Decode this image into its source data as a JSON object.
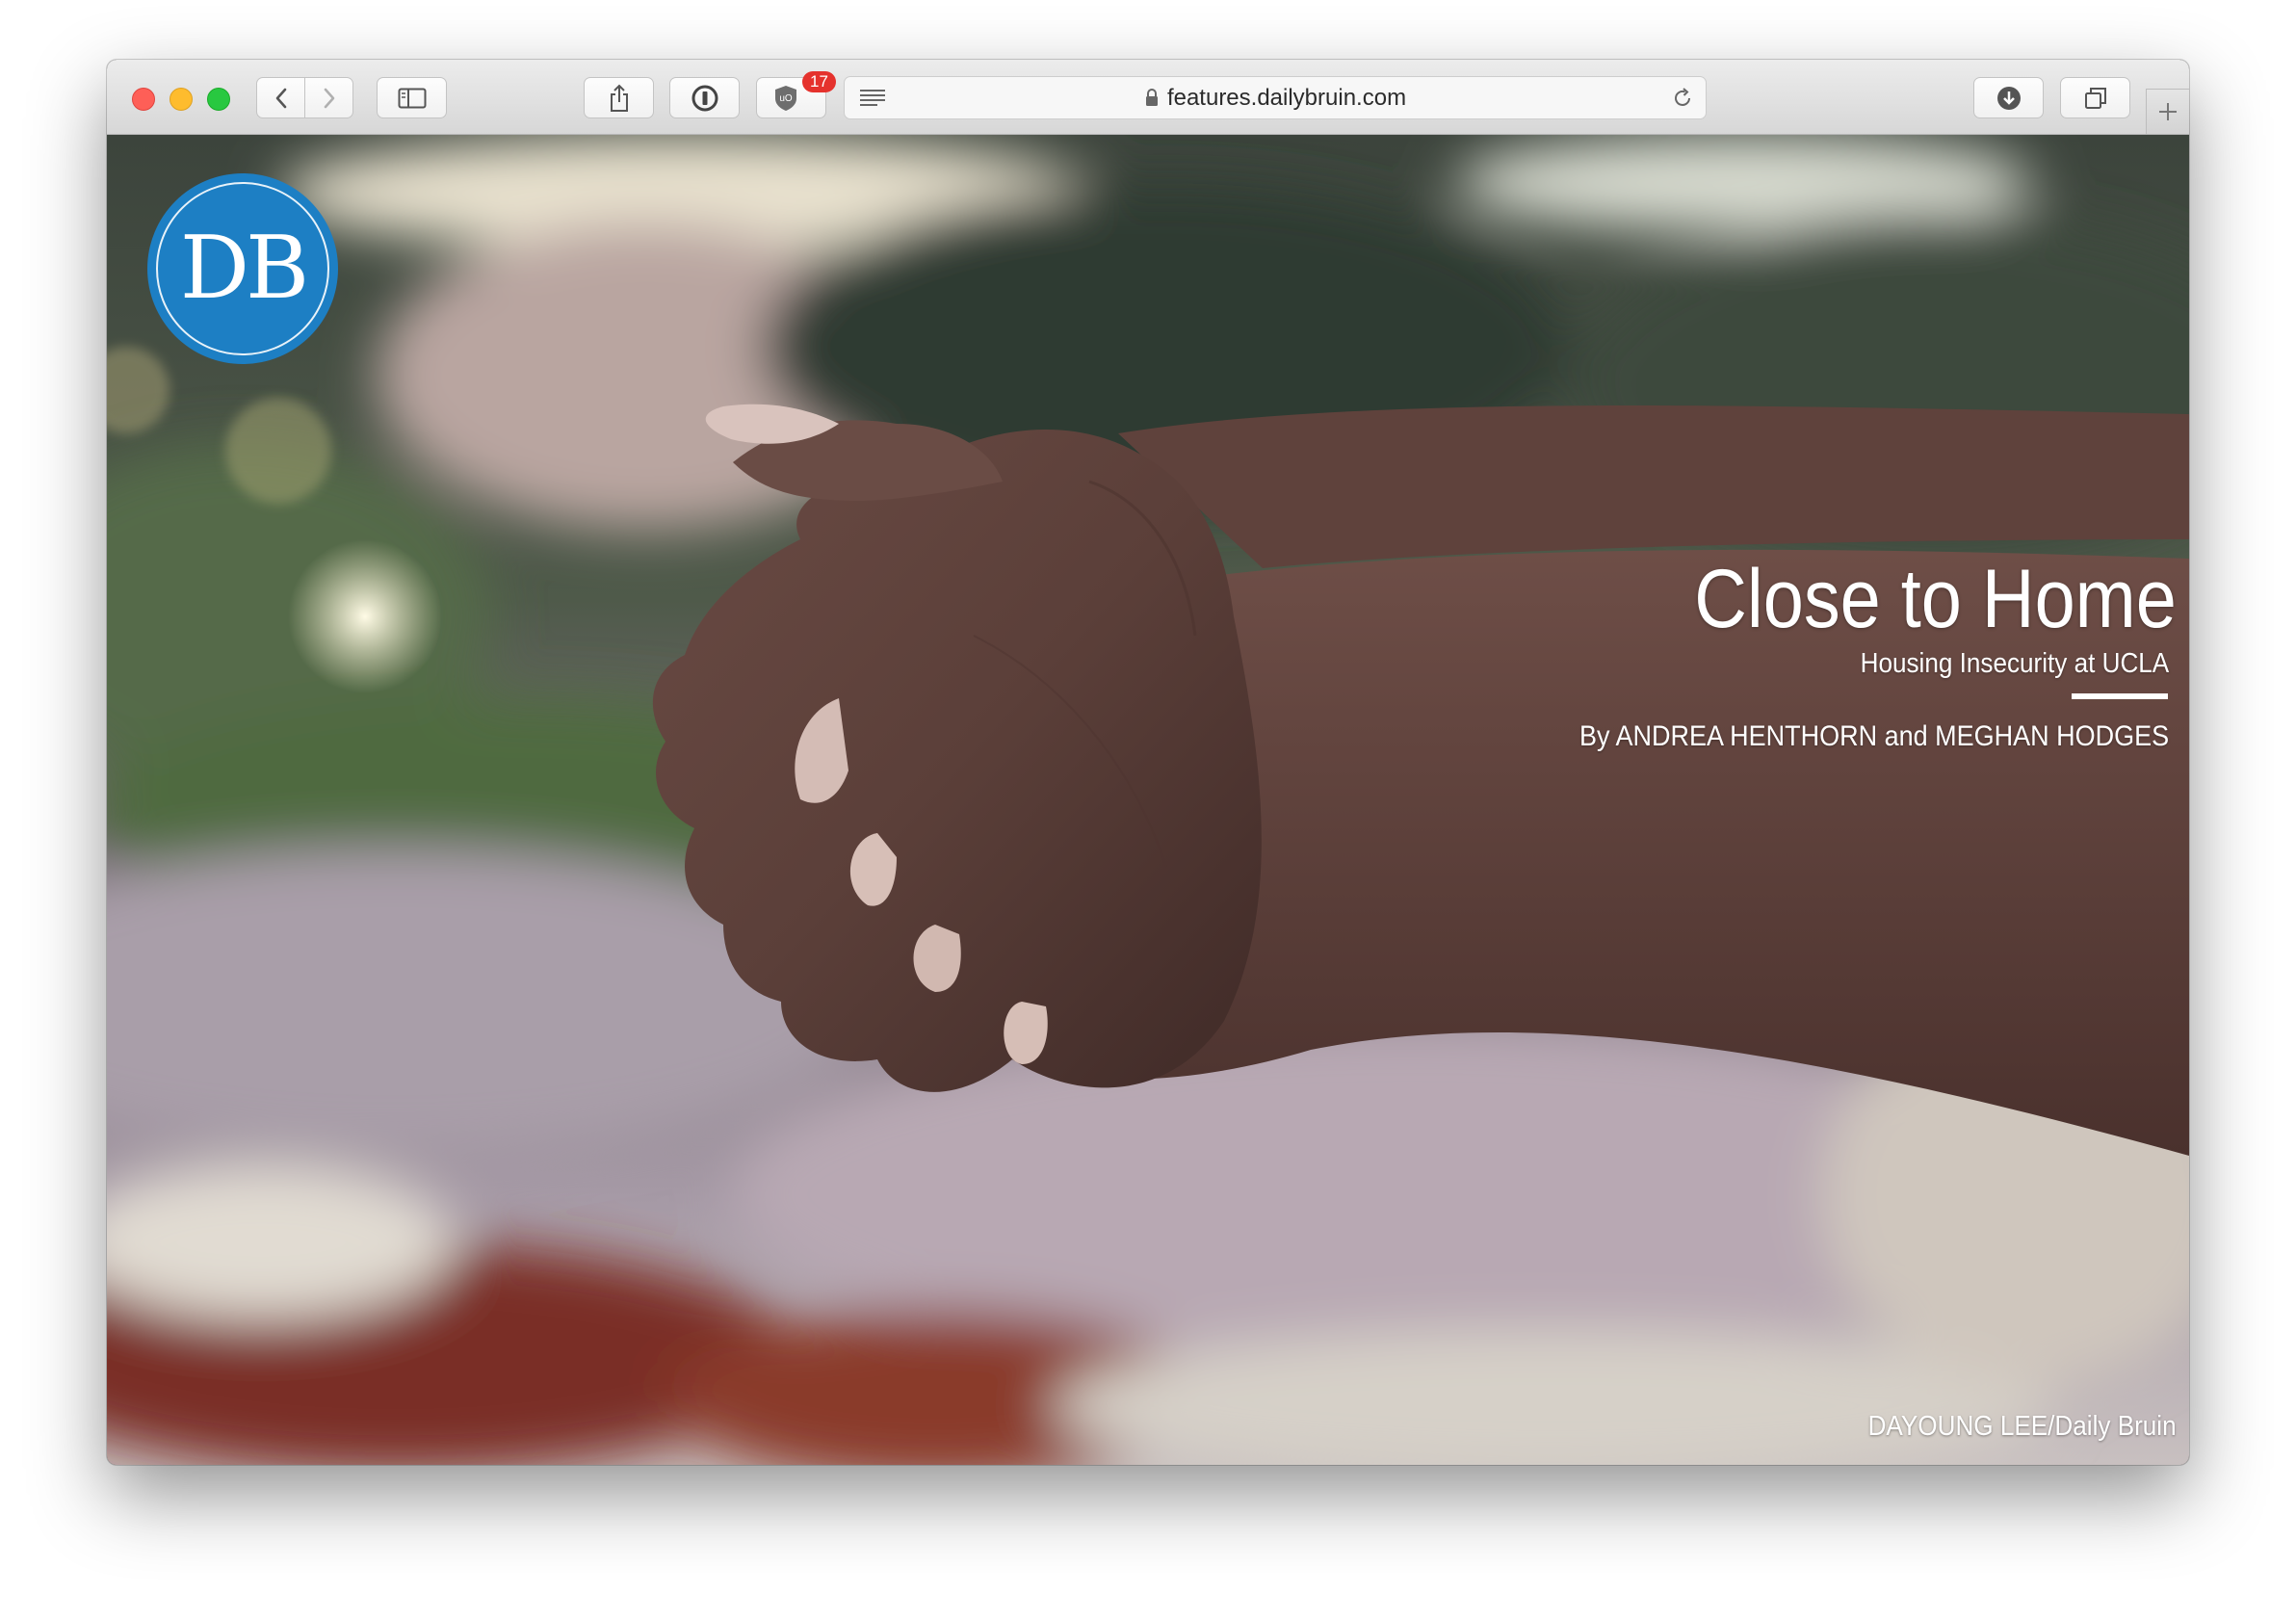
{
  "browser": {
    "url": "features.dailybruin.com",
    "extension_badge_count": "17"
  },
  "logo": {
    "text": "DB",
    "color": "#1d7fc4"
  },
  "article": {
    "title": "Close to Home",
    "subtitle": "Housing Insecurity at UCLA",
    "byline": "By ANDREA HENTHORN and MEGHAN HODGES",
    "photo_credit": "DAYOUNG LEE/Daily Bruin"
  },
  "icons": [
    "back-icon",
    "forward-icon",
    "sidebar-icon",
    "share-icon",
    "password-manager-icon",
    "ublock-shield-icon",
    "reader-icon",
    "lock-icon",
    "reload-icon",
    "download-icon",
    "tabs-overview-icon",
    "plus-icon"
  ]
}
